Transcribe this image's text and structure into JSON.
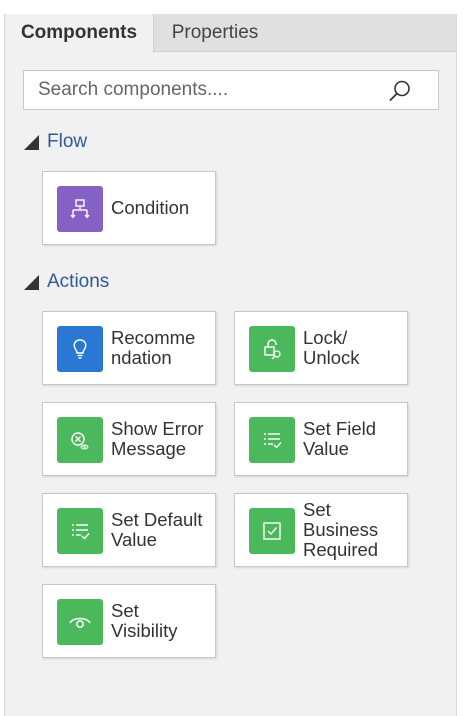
{
  "tabs": [
    {
      "label": "Components",
      "active": true
    },
    {
      "label": "Properties",
      "active": false
    }
  ],
  "search": {
    "placeholder": "Search components...."
  },
  "sections": {
    "flow": {
      "label": "Flow"
    },
    "actions": {
      "label": "Actions"
    }
  },
  "components": {
    "condition": {
      "label": "Condition",
      "icon": "condition-icon",
      "color": "#8661c5"
    },
    "recommendation": {
      "label": "Recomme ndation",
      "line1": "Recomme",
      "line2": "ndation",
      "icon": "lightbulb-icon",
      "color": "#2b78d4"
    },
    "lock_unlock": {
      "label": "Lock/ Unlock",
      "line1": "Lock/",
      "line2": "Unlock",
      "icon": "lock-icon",
      "color": "#4cb85c"
    },
    "show_error_message": {
      "label": "Show Error Message",
      "line1": "Show Error",
      "line2": "Message",
      "icon": "error-message-icon",
      "color": "#4cb85c"
    },
    "set_field_value": {
      "label": "Set Field Value",
      "line1": "Set Field",
      "line2": "Value",
      "icon": "field-value-icon",
      "color": "#4cb85c"
    },
    "set_default_value": {
      "label": "Set Default Value",
      "line1": "Set Default",
      "line2": "Value",
      "icon": "default-value-icon",
      "color": "#4cb85c"
    },
    "set_business_required": {
      "label": "Set Business Required",
      "line1": "Set",
      "line2": "Business",
      "line3": "Required",
      "icon": "checkbox-icon",
      "color": "#4cb85c"
    },
    "set_visibility": {
      "label": "Set Visibility",
      "line1": "Set",
      "line2": "Visibility",
      "icon": "eye-icon",
      "color": "#4cb85c"
    }
  }
}
